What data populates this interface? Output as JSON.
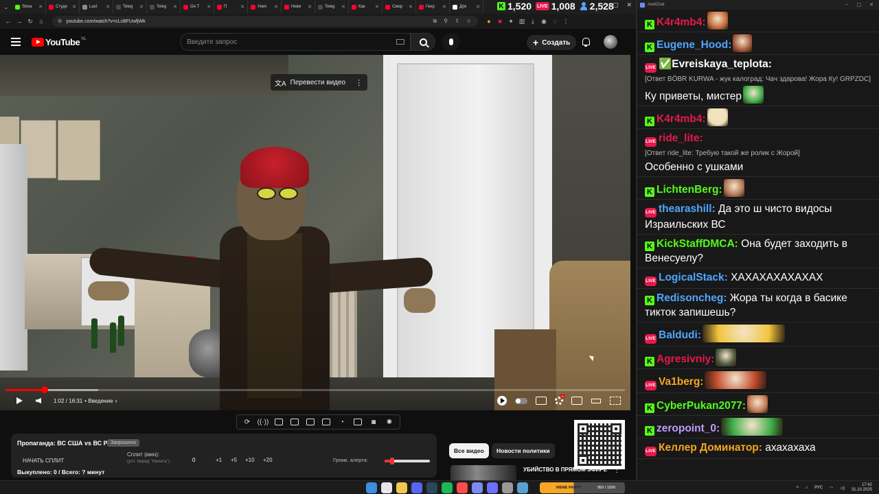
{
  "browser": {
    "tabs": [
      {
        "label": "Strea",
        "color": "#53fc18"
      },
      {
        "label": "Студи",
        "color": "#ff0033"
      },
      {
        "label": "Last",
        "color": "#8c8c8c"
      },
      {
        "label": "Teleg",
        "color": "#4a4a4a"
      },
      {
        "label": "Teleg",
        "color": "#4a4a4a"
      },
      {
        "label": "Он Т",
        "color": "#ff0033"
      },
      {
        "label": "П",
        "color": "#ff0033"
      },
      {
        "label": "Унич",
        "color": "#ff0033"
      },
      {
        "label": "Неви",
        "color": "#ff0033"
      },
      {
        "label": "Teleg",
        "color": "#4a4a4a"
      },
      {
        "label": "Как",
        "color": "#ff0033"
      },
      {
        "label": "Смер",
        "color": "#ff0033"
      },
      {
        "label": "Генр",
        "color": "#ff0033"
      },
      {
        "label": "Д(м",
        "color": "#ffffff"
      }
    ],
    "url": "youtube.com/watch?v=cLcBFUwfjWk"
  },
  "overlay": {
    "kick_viewers": "1,520",
    "live_viewers": "1,008",
    "total_viewers": "2,528"
  },
  "youtube": {
    "logo_text": "YouTube",
    "country_code": "NL",
    "search_placeholder": "Введите запрос",
    "create_label": "Создать"
  },
  "player": {
    "translate_label": "Перевести видео",
    "time": "1:02 / 16:31",
    "chapter": "• Введение",
    "progress_fraction": 0.063,
    "buffer_fraction": 0.15
  },
  "panel": {
    "title": "Пропаганда: ВС США vs ВС РФ",
    "badge": "Запрошено",
    "start_split": "НАЧАТЬ СПЛИТ",
    "split_label": "Сплит (мин):",
    "split_hint": "(уст. перед \"Начать\")",
    "split_value": "0",
    "steps": [
      "+1",
      "+5",
      "+10",
      "+20"
    ],
    "alert_volume_label": "Громк. алерта:",
    "alert_volume_fraction": 0.12,
    "bought": "Выкуплено: 0 / Всего: ? минут"
  },
  "related": {
    "chips": [
      "Все видео",
      "Новости политики"
    ],
    "rec_title": "УБИЙСТВО В ПРЯМОМ ЭФИРЕ"
  },
  "chat": {
    "window_title": "AxelChat",
    "messages": [
      {
        "platform": "kick",
        "user": "K4r4mb4:",
        "color": "#e5194c",
        "text": "",
        "emotes": [
          {
            "w": 30,
            "color": "#c46b3a"
          }
        ]
      },
      {
        "platform": "kick",
        "user": "Eugene_Hood:",
        "color": "#4fa6ff",
        "text": "",
        "emotes": [
          {
            "w": 28,
            "color": "#a5593a"
          }
        ]
      },
      {
        "platform": "live",
        "user": "✅Evreiskaya_teplota:",
        "color": "#ffffff",
        "reply": "[Ответ BÖBR KURWA - жук калоград: Чач здарова! Жора Ку! GRPZDC]",
        "text": "Ку приветы, мистер",
        "emotes": [
          {
            "w": 30,
            "color": "#3fae49"
          }
        ]
      },
      {
        "platform": "kick",
        "user": "K4r4mb4:",
        "color": "#e5194c",
        "text": "",
        "emotes": [
          {
            "w": 30,
            "color": "#f2e2b8"
          }
        ]
      },
      {
        "platform": "live",
        "user": "ride_lite:",
        "color": "#e5194c",
        "reply": "[Ответ ride_lite: Требую такой же ролик с Жорой]",
        "text": "Особенно с ушками",
        "emotes": []
      },
      {
        "platform": "kick",
        "user": "LichtenBerg:",
        "color": "#53fc18",
        "text": "",
        "emotes": [
          {
            "w": 30,
            "color": "#b5775a"
          }
        ]
      },
      {
        "platform": "live",
        "user": "thearashill:",
        "color": "#4fa6ff",
        "text": "Да это ш чисто видосы Израильских ВС",
        "emotes": []
      },
      {
        "platform": "kick",
        "user": "KickStaffDMCA:",
        "color": "#53fc18",
        "text": "Она будет заходить в Венесуелу?",
        "emotes": []
      },
      {
        "platform": "live",
        "user": "LogicalStack:",
        "color": "#4fa6ff",
        "text": "ХАХАХАХАХАХАХ",
        "emotes": []
      },
      {
        "platform": "kick",
        "user": "Redisoncheg:",
        "color": "#4fa6ff",
        "text": "Жора ты когда в басике тикток запишешь?",
        "emotes": []
      },
      {
        "platform": "live",
        "user": "Baldudi:",
        "color": "#4fa6ff",
        "text": "",
        "emotes": [
          {
            "w": 120,
            "color": "#f2c53d"
          }
        ]
      },
      {
        "platform": "kick",
        "user": "Agresivniy:",
        "color": "#e5194c",
        "text": "",
        "emotes": [
          {
            "w": 30,
            "color": "#4e5a3c"
          }
        ]
      },
      {
        "platform": "live",
        "user": "Va1berg:",
        "color": "#f5a623",
        "text": "",
        "emotes": [
          {
            "w": 90,
            "color": "#c24a2e"
          }
        ]
      },
      {
        "platform": "kick",
        "user": "CyberPukan2077:",
        "color": "#53fc18",
        "text": "",
        "emotes": [
          {
            "w": 30,
            "color": "#c47a55"
          }
        ]
      },
      {
        "platform": "kick",
        "user": "zeropoint_0:",
        "color": "#c29bff",
        "text": "",
        "emotes": [
          {
            "w": 90,
            "color": "#3fae49"
          }
        ]
      },
      {
        "platform": "live",
        "user": "Келлер Доминатор:",
        "color": "#f5a623",
        "text": "ахахахаха",
        "emotes": []
      }
    ]
  },
  "taskbar": {
    "widget_label": "MEME PARTY",
    "widget_counter": "950 / 1500",
    "lang": "РУС",
    "time": "17:42",
    "date": "31.10.2025",
    "icon_colors": [
      "#3d8ee0",
      "#e8e8e8",
      "#f2c94c",
      "#5865f2",
      "#2a475e",
      "#1db954",
      "#ff4a4a",
      "#7c8af5",
      "#6e6eff",
      "#999999",
      "#5aa0d0"
    ]
  },
  "colors": {
    "kick": "#53fc18",
    "live": "#e5194c",
    "youtube_red": "#ff0000"
  }
}
